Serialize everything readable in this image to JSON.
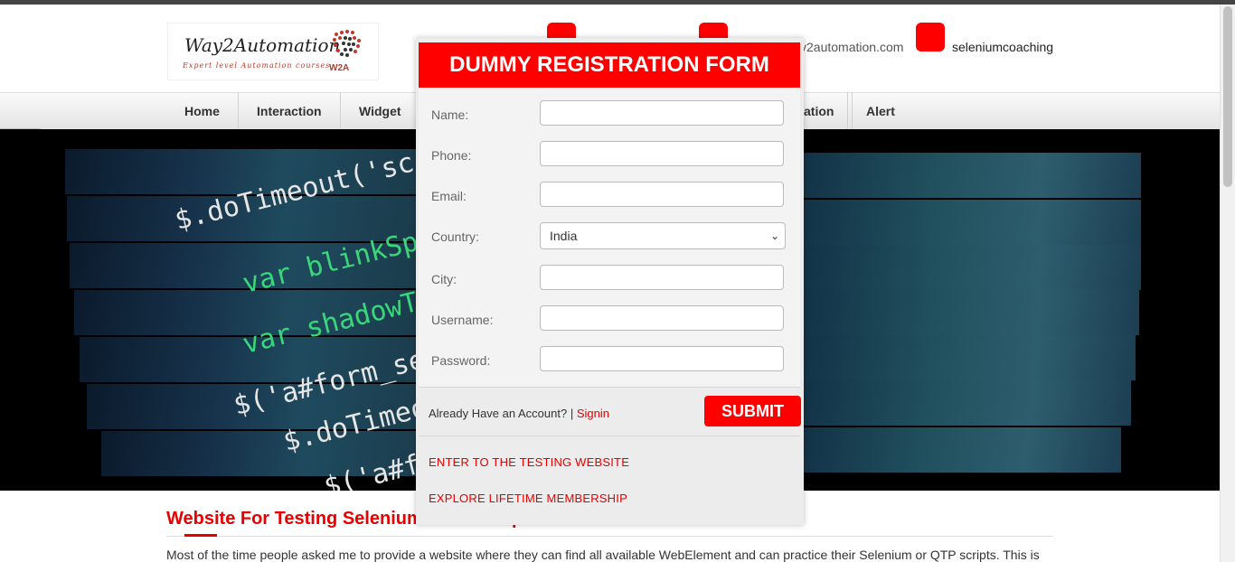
{
  "header": {
    "logo_brand": "Way2Automation",
    "logo_tagline": "Expert level Automation courses",
    "logo_mark": "W2A",
    "email_partial": "y2automation.com",
    "skype_id": "seleniumcoaching"
  },
  "nav": {
    "items": [
      {
        "label": "Home"
      },
      {
        "label": "Interaction"
      },
      {
        "label": "Widget"
      },
      {
        "label": "ation"
      },
      {
        "label": "Alert"
      }
    ]
  },
  "modal": {
    "title": "DUMMY REGISTRATION FORM",
    "fields": {
      "name_label": "Name:",
      "phone_label": "Phone:",
      "email_label": "Email:",
      "country_label": "Country:",
      "country_value": "India",
      "city_label": "City:",
      "username_label": "Username:",
      "password_label": "Password:"
    },
    "already_text": "Already Have an Account? |",
    "signin_label": "Signin",
    "submit_label": "SUBMIT",
    "enter_link": "ENTER TO THE TESTING WEBSITE",
    "membership_link": "EXPLORE LIFETIME MEMBERSHIP"
  },
  "banner": {
    "code_lines": [
      "$.doTimeout('sc",
      "var blinkSp",
      "var shadowT",
      "$('a#form_se",
      "$.doTimeou",
      "$('a#for"
    ]
  },
  "content": {
    "title_partial": "Website For Testing Selenium",
    "title_tail": "p",
    "paragraph": "Most of the time people asked me to provide a website where they can find all available WebElement and can practice their Selenium or QTP scripts. This is"
  },
  "colors": {
    "accent": "#ff0000",
    "title_red": "#e60000"
  }
}
